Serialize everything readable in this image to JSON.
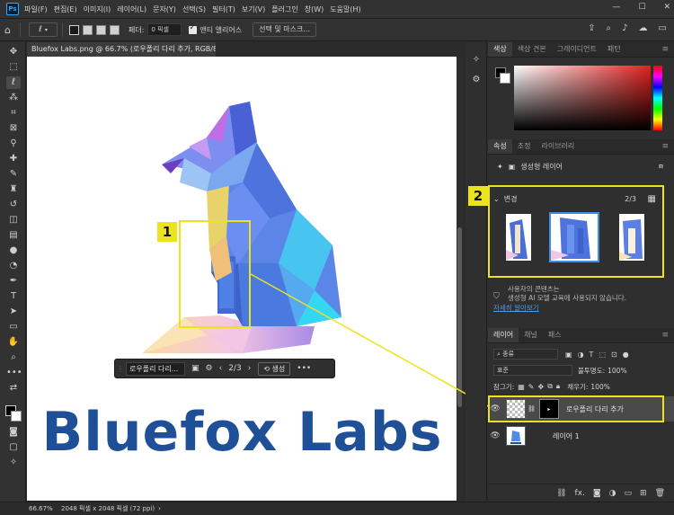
{
  "app": {
    "logo": "Ps",
    "menu": [
      "파일(F)",
      "편집(E)",
      "이미지(I)",
      "레이어(L)",
      "문자(Y)",
      "선택(S)",
      "필터(T)",
      "보기(V)",
      "플러그인",
      "창(W)",
      "도움말(H)"
    ],
    "window_controls": [
      "—",
      "☐",
      "✕"
    ]
  },
  "options_bar": {
    "feather_label": "페더:",
    "feather_value": "0 픽셀",
    "antialias_label": "앤티 앨리어스",
    "select_mask_label": "선택 및 마스크..."
  },
  "document": {
    "tab_title": "Bluefox Labs.png @ 66.7% (로우폴리 다리 추가, RGB/8#) *",
    "tab_close": "×",
    "brand_text": "Bluefox Labs",
    "zoom": "66.67%",
    "size_info": "2048 픽셀 x 2048 픽셀 (72 ppi)"
  },
  "contextual_bar": {
    "prompt": "로우폴리 다리...",
    "page": "2/3",
    "generate_label": "생성",
    "more": "•••"
  },
  "callouts": {
    "one": "1",
    "two": "2"
  },
  "colour_panel": {
    "tabs": [
      "색상",
      "색상 견본",
      "그레이디언트",
      "패턴"
    ]
  },
  "properties_panel": {
    "tabs": [
      "속성",
      "조정",
      "라이브러리"
    ],
    "layer_type": "생성형 레이어",
    "variations_title": "변경",
    "variations_count": "2/3",
    "notice_title": "사용자의 콘텐츠는",
    "notice_body": "생성형 AI 모델 교육에 사용되지 않습니다.",
    "learn_more": "자세히 알아보기"
  },
  "layers_panel": {
    "tabs": [
      "레이어",
      "채널",
      "패스"
    ],
    "filter_kind": "종류",
    "blend_mode": "표준",
    "opacity_label": "불투명도:",
    "opacity_value": "100%",
    "lock_label": "잠그기:",
    "fill_label": "채우기:",
    "fill_value": "100%",
    "layers": [
      {
        "name": "로우폴리 다리 추가",
        "selected": true
      },
      {
        "name": "레이어 1",
        "selected": false
      }
    ],
    "footer_fx": "fx."
  },
  "colors": {
    "accent_yellow": "#ece31f",
    "brand_blue": "#1e4f97",
    "selection_blue": "#3a8ee6"
  }
}
